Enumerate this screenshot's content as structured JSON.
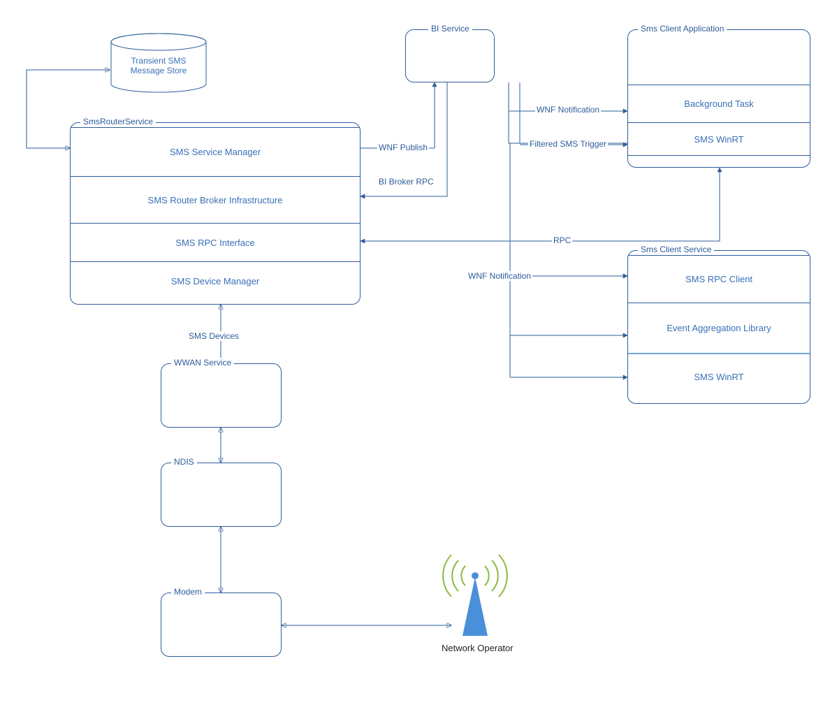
{
  "nodes": {
    "transientStore": "Transient SMS\nMessage Store",
    "smsRouter": {
      "title": "SmsRouterService",
      "rows": [
        "SMS Service Manager",
        "SMS Router Broker Infrastructure",
        "SMS RPC Interface",
        "SMS Device Manager"
      ]
    },
    "biService": {
      "title": "BI Service"
    },
    "smsClientApp": {
      "title": "Sms Client Application",
      "rows": [
        "Background Task",
        "SMS WinRT"
      ]
    },
    "smsClientService": {
      "title": "Sms Client Service",
      "rows": [
        "SMS RPC Client",
        "Event Aggregation Library",
        "SMS WinRT"
      ]
    },
    "wwan": {
      "title": "WWAN Service"
    },
    "ndis": {
      "title": "NDIS"
    },
    "modem": {
      "title": "Modem"
    },
    "networkOperator": "Network Operator"
  },
  "edges": {
    "wnfPublish": "WNF Publish",
    "biBrokerRpc": "BI Broker RPC",
    "wnfNotification": "WNF Notification",
    "filteredSmsTrigger": "Filtered SMS Trigger",
    "rpc": "RPC",
    "wnfNotification2": "WNF Notification",
    "smsDevices": "SMS Devices"
  }
}
